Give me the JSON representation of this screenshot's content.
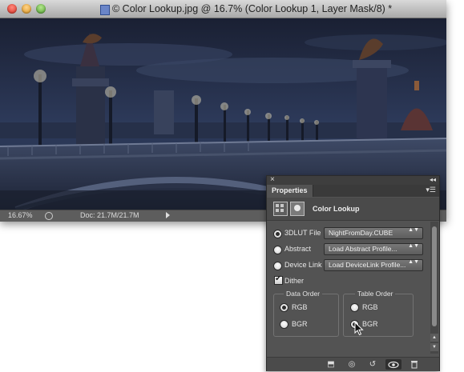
{
  "window": {
    "title": "© Color Lookup.jpg @ 16.7% (Color Lookup 1, Layer Mask/8) *",
    "icons": [
      "close-button",
      "minimize-button",
      "zoom-button",
      "document-icon"
    ]
  },
  "statusbar": {
    "zoom": "16.67%",
    "doc_info": "Doc: 21.7M/21.7M"
  },
  "panel": {
    "close_glyph": "×",
    "collapse_glyph": "◂◂",
    "tab_label": "Properties",
    "menu_glyph": "▾☰",
    "adjustment_title": "Color Lookup",
    "rows": [
      {
        "label": "3DLUT File",
        "selected": true,
        "value": "NightFromDay.CUBE"
      },
      {
        "label": "Abstract",
        "selected": false,
        "value": "Load Abstract Profile..."
      },
      {
        "label": "Device Link",
        "selected": false,
        "value": "Load DeviceLink Profile..."
      }
    ],
    "dither": {
      "label": "Dither",
      "checked": true
    },
    "data_order": {
      "title": "Data Order",
      "options": [
        "RGB",
        "BGR"
      ],
      "selected": "RGB"
    },
    "table_order": {
      "title": "Table Order",
      "options": [
        "RGB",
        "BGR"
      ],
      "selected": "BGR"
    },
    "dropdown_arrows": "▲▼",
    "scroll_up": "▲",
    "scroll_down": "▼",
    "bottom_buttons": [
      {
        "name": "clip-to-layer-button",
        "glyph": "⬒"
      },
      {
        "name": "view-previous-state-button",
        "glyph": "◎"
      },
      {
        "name": "reset-button",
        "glyph": "↺"
      },
      {
        "name": "visibility-toggle-button",
        "glyph": "👁"
      },
      {
        "name": "delete-button",
        "glyph": "🗑"
      }
    ]
  },
  "colors": {
    "panel_bg": "#535353",
    "sky": "#1f2638",
    "photo_tone": "#2b3550"
  }
}
